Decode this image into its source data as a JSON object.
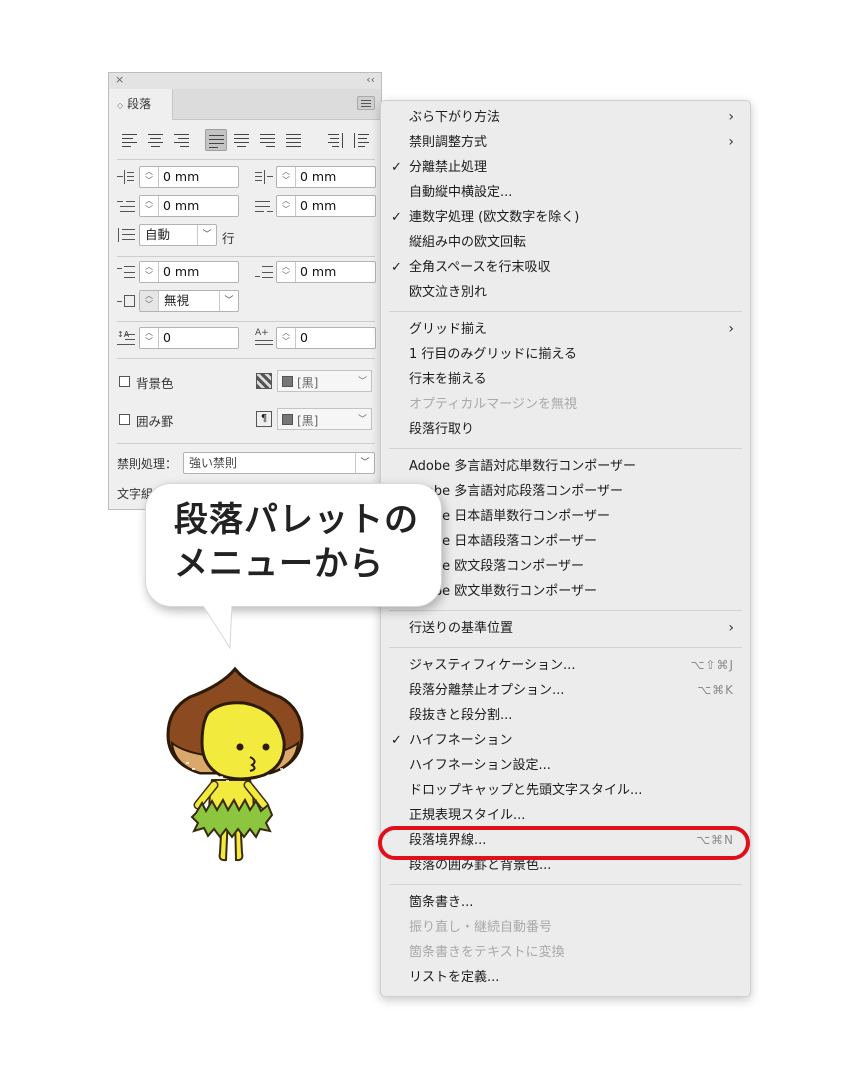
{
  "panel": {
    "close_glyph": "×",
    "collapse_glyph": "‹‹",
    "tab_arrow": "◇",
    "tab_label": "段落",
    "left_indent": "0 mm",
    "right_indent": "0 mm",
    "first_line_indent": "0 mm",
    "last_line_indent": "0 mm",
    "autoleading_value": "自動",
    "autoleading_unit": "行",
    "space_before": "0 mm",
    "space_after": "0 mm",
    "grid_align": "無視",
    "drop_cap_lines": "0",
    "drop_cap_chars": "0",
    "bg_color_label": "背景色",
    "bg_color_value": "[黒]",
    "border_label": "囲み罫",
    "border_value": "[黒]",
    "kinsoku_label": "禁則処理：",
    "kinsoku_value": "強い禁則",
    "moji_label": "文字組"
  },
  "menu": {
    "items": [
      {
        "label": "ぶら下がり方法",
        "submenu": "›"
      },
      {
        "label": "禁則調整方式",
        "submenu": "›"
      },
      {
        "label": "分離禁止処理",
        "check": "✓"
      },
      {
        "label": "自動縦中横設定..."
      },
      {
        "label": "連数字処理 (欧文数字を除く)",
        "check": "✓"
      },
      {
        "label": "縦組み中の欧文回転"
      },
      {
        "label": "全角スペースを行末吸収",
        "check": "✓"
      },
      {
        "label": "欧文泣き別れ"
      },
      {
        "label": "グリッド揃え",
        "submenu": "›"
      },
      {
        "label": "1 行目のみグリッドに揃える"
      },
      {
        "label": "行末を揃える"
      },
      {
        "label": "オプティカルマージンを無視"
      },
      {
        "label": "段落行取り"
      },
      {
        "label": "Adobe 多言語対応単数行コンポーザー"
      },
      {
        "label": "Adobe 多言語対応段落コンポーザー"
      },
      {
        "label": "Adobe 日本語単数行コンポーザー"
      },
      {
        "label": "Adobe 日本語段落コンポーザー"
      },
      {
        "label": "Adobe 欧文段落コンポーザー"
      },
      {
        "label": "Adobe 欧文単数行コンポーザー"
      },
      {
        "label": "行送りの基準位置",
        "submenu": "›"
      },
      {
        "label": "ジャスティフィケーション...",
        "shortcut": "⌥⇧⌘J"
      },
      {
        "label": "段落分離禁止オプション...",
        "shortcut": "⌥⌘K"
      },
      {
        "label": "段抜きと段分割..."
      },
      {
        "label": "ハイフネーション",
        "check": "✓"
      },
      {
        "label": "ハイフネーション設定..."
      },
      {
        "label": "ドロップキャップと先頭文字スタイル..."
      },
      {
        "label": "正規表現スタイル..."
      },
      {
        "label": "段落境界線...",
        "shortcut": "⌥⌘N"
      },
      {
        "label": "段落の囲み罫と背景色..."
      },
      {
        "label": "箇条書き..."
      },
      {
        "label": "振り直し・継続自動番号"
      },
      {
        "label": "箇条書きをテキストに変換"
      },
      {
        "label": "リストを定義..."
      }
    ]
  },
  "bubble": {
    "line1": "段落パレットの",
    "line2": "メニューから"
  },
  "colors": {
    "highlight": "#e0101a",
    "chestnut_shell": "#8b4a20",
    "chestnut_face": "#f2ea3c",
    "skirt": "#8cc63f"
  }
}
